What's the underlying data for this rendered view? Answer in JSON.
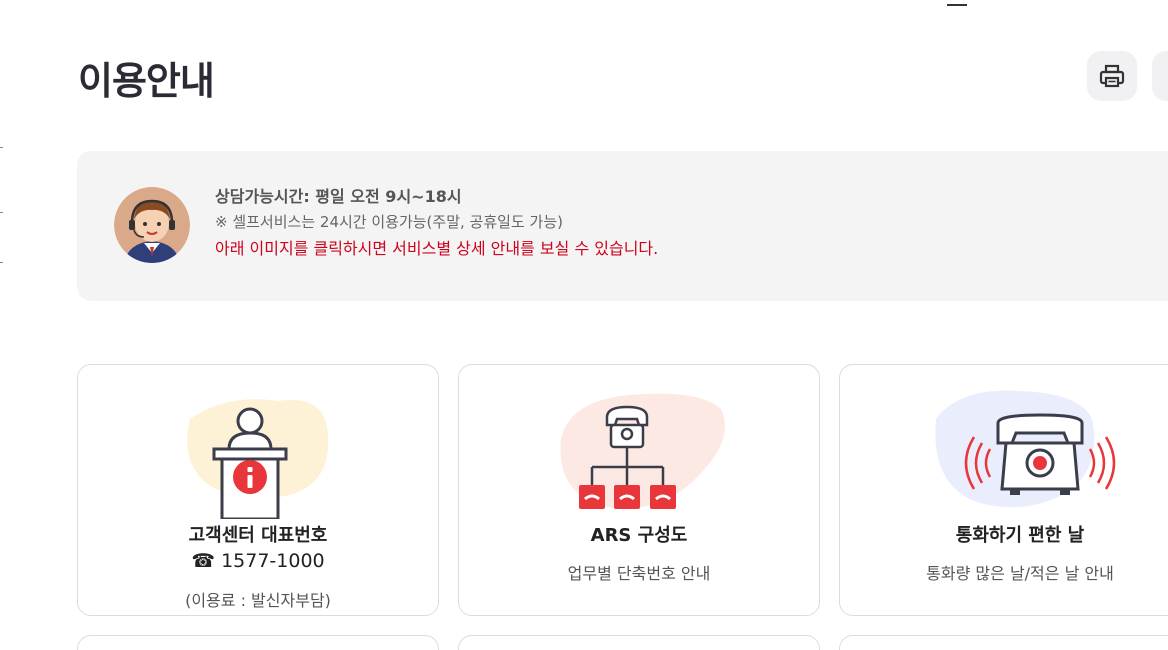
{
  "page": {
    "title": "이용안내"
  },
  "toolbar": {
    "print_icon": "printer-icon",
    "share_icon": "share-icon"
  },
  "consult": {
    "hours": "상담가능시간: 평일 오전 9시~18시",
    "self_service": "※ 셀프서비스는 24시간 이용가능(주말, 공휴일도 가능)",
    "notice": "아래 이미지를 클릭하시면 서비스별 상세 안내를 보실 수 있습니다."
  },
  "cards": [
    {
      "title": "고객센터 대표번호",
      "phone": "☎ 1577-1000",
      "sub": "(이용료 : 발신자부담)",
      "icon": "info-desk-icon"
    },
    {
      "title": "ARS 구성도",
      "sub": "업무별 단축번호 안내",
      "icon": "ars-tree-icon"
    },
    {
      "title": "통화하기 편한 날",
      "sub": "통화량 많은 날/적은 날 안내",
      "icon": "ringing-phone-icon"
    }
  ],
  "colors": {
    "accent_red": "#d0021b",
    "icon_red": "#e8363a",
    "info_bg": "#f4f4f5"
  }
}
